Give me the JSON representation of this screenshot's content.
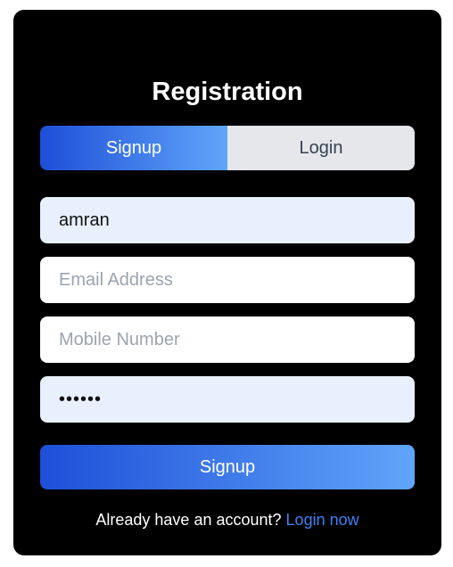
{
  "form": {
    "title": "Registration",
    "tabs": [
      {
        "label": "Signup",
        "active": true
      },
      {
        "label": "Login",
        "active": false
      }
    ],
    "fields": {
      "name": {
        "value": "amran",
        "placeholder": ""
      },
      "email": {
        "value": "",
        "placeholder": "Email Address"
      },
      "mobile": {
        "value": "",
        "placeholder": "Mobile Number"
      },
      "password": {
        "value": "••••••",
        "placeholder": ""
      }
    },
    "submit_label": "Signup",
    "footer_text": "Already have an account?",
    "footer_link": "Login now"
  },
  "colors": {
    "card_background": "#000000",
    "gradient_start": "#1e4fd8",
    "gradient_end": "#60a5fa",
    "link": "#3b82f6",
    "filled_field": "#e8f0fe"
  }
}
